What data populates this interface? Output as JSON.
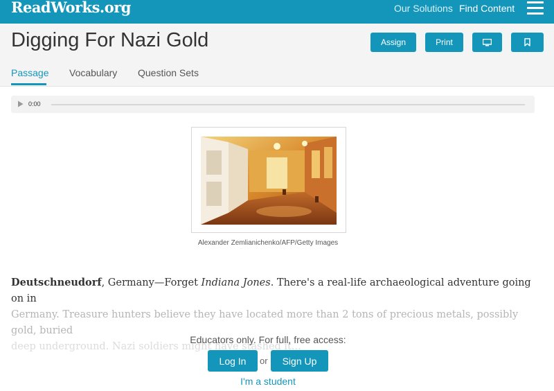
{
  "site": {
    "logo": "ReadWorks.org",
    "nav": {
      "our_solutions": "Our Solutions",
      "find_content": "Find Content"
    }
  },
  "header": {
    "title": "Digging For Nazi Gold",
    "buttons": {
      "assign": "Assign",
      "print": "Print",
      "present_icon": "monitor-icon",
      "bookmark_icon": "bookmark-icon"
    },
    "tabs": [
      {
        "label": "Passage",
        "active": true
      },
      {
        "label": "Vocabulary",
        "active": false
      },
      {
        "label": "Question Sets",
        "active": false
      }
    ]
  },
  "audio": {
    "time": "0:00",
    "progress": 0
  },
  "figure": {
    "caption": "Alexander Zemlianichenko/AFP/Getty Images"
  },
  "passage": {
    "dateline": "Deutschneudorf",
    "line1_a": ", Germany—Forget ",
    "line1_italic": "Indiana Jones",
    "line1_b": ". There's a real-life archaeological adventure going on in",
    "line2": "Germany. Treasure hunters believe they have located more than 2 tons of precious metals, possibly gold, buried",
    "line3": "deep underground. Nazi soldiers might have stashed it..."
  },
  "gate": {
    "message": "Educators only. For full, free access:",
    "login": "Log In",
    "or": "or",
    "signup": "Sign Up",
    "student": "I'm a student"
  },
  "colors": {
    "brand": "#1496bb",
    "header_bg": "#f4f4f4"
  }
}
